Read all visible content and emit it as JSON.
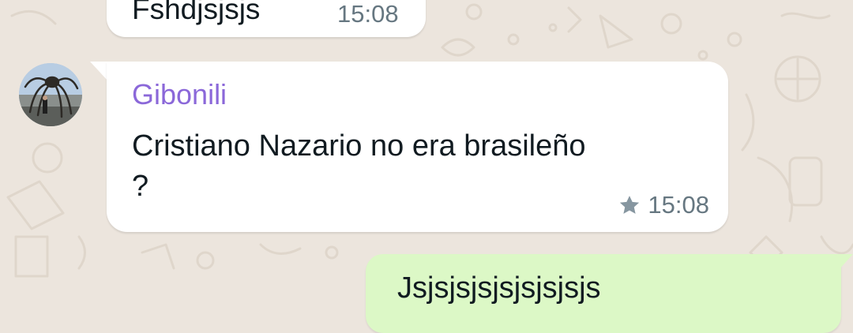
{
  "chat": {
    "previous_message": {
      "text": "Fshdjsjsjs",
      "time": "15:08"
    },
    "message": {
      "sender": "Gibonili",
      "text": "Cristiano Nazario no era brasileño ?",
      "time": "15:08",
      "starred": true,
      "icon": "star-icon"
    },
    "outgoing_message": {
      "text": "Jsjsjsjsjsjsjsjsjs"
    }
  },
  "colors": {
    "background": "#ece5dd",
    "incoming_bubble": "#ffffff",
    "outgoing_bubble": "#dcf8c6",
    "sender_name": "#8b68d9",
    "text": "#111b21",
    "meta": "#667781"
  }
}
